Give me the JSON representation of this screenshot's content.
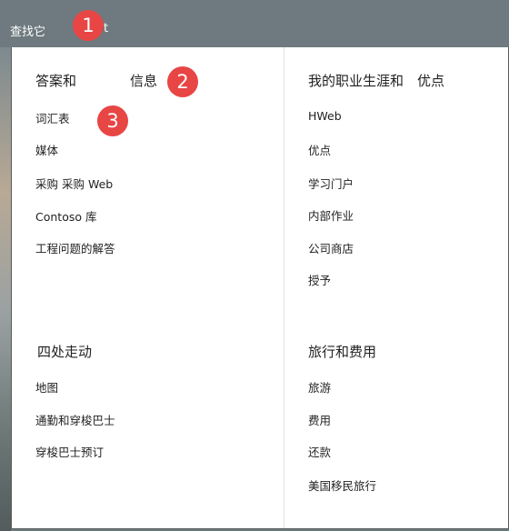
{
  "topbar": {
    "find_label": "查找它",
    "trailing_text": "t"
  },
  "callouts": [
    "1",
    "2",
    "3"
  ],
  "left_column": {
    "section1": {
      "heading_a": "答案和",
      "heading_b": "信息",
      "items": [
        "词汇表",
        "媒体",
        "采购 采购 Web",
        "Contoso 库",
        "工程问题的解答"
      ]
    },
    "section2": {
      "heading": "四处走动",
      "items": [
        "地图",
        "通勤和穿梭巴士",
        "穿梭巴士预订"
      ]
    }
  },
  "right_column": {
    "section1": {
      "heading_a": "我的职业生涯和",
      "heading_b": "优点",
      "items": [
        "HWeb",
        "优点",
        "学习门户",
        "内部作业",
        "公司商店",
        "授予"
      ]
    },
    "section2": {
      "heading": "旅行和费用",
      "items": [
        "旅游",
        "费用",
        "还款",
        "美国移民旅行"
      ]
    }
  }
}
